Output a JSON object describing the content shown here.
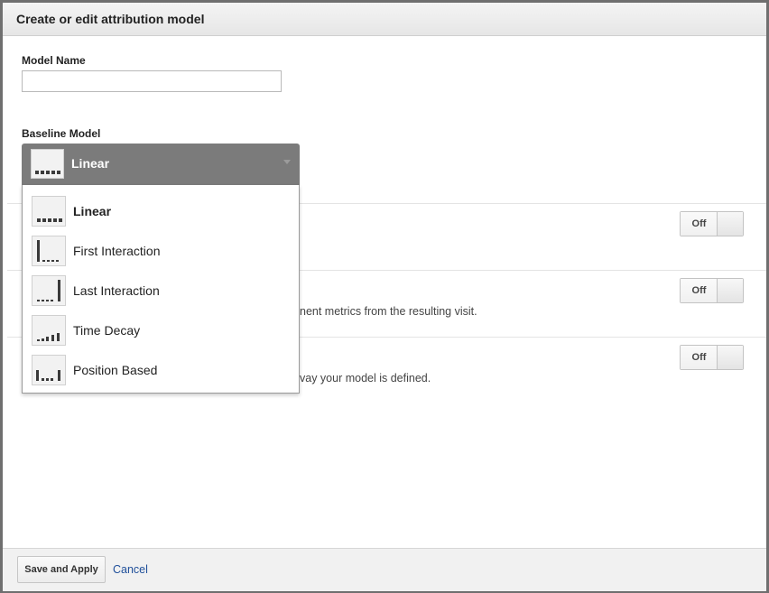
{
  "dialog": {
    "title": "Create or edit attribution model"
  },
  "model_name": {
    "label": "Model Name",
    "value": "",
    "placeholder": ""
  },
  "baseline": {
    "label": "Baseline Model",
    "selected": "Linear",
    "selected_icon": "linear-model-icon",
    "options": [
      {
        "label": "Linear",
        "icon": "linear-model-icon",
        "selected": true
      },
      {
        "label": "First Interaction",
        "icon": "first-interaction-model-icon",
        "selected": false
      },
      {
        "label": "Last Interaction",
        "icon": "last-interaction-model-icon",
        "selected": false
      },
      {
        "label": "Time Decay",
        "icon": "time-decay-model-icon",
        "selected": false
      },
      {
        "label": "Position Based",
        "icon": "position-based-model-icon",
        "selected": false
      }
    ]
  },
  "settings": [
    {
      "description": "",
      "toggle_label": "Off"
    },
    {
      "description": "nent metrics from the resulting visit.",
      "toggle_label": "Off"
    },
    {
      "description": "vay your model is defined.",
      "toggle_label": "Off"
    }
  ],
  "footer": {
    "save_label": "Save and Apply",
    "cancel_label": "Cancel"
  },
  "colors": {
    "select_bg": "#7b7b7b",
    "link": "#1f4f9a",
    "border": "#6f6f6f"
  }
}
